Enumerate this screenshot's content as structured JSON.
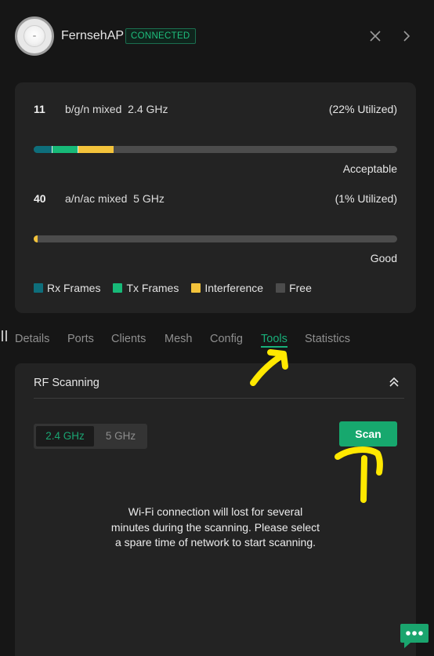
{
  "header": {
    "device_name": "FernsehAP",
    "status": "CONNECTED",
    "icons": {
      "avatar": "access-point-device",
      "close": "close-icon",
      "next": "chevron-right-icon"
    }
  },
  "radios": [
    {
      "channel": "11",
      "mode": "b/g/n mixed  2.4 GHz",
      "utilization": "(22% Utilized)",
      "quality": "Acceptable",
      "segments": {
        "rx_percent": 5,
        "tx_percent": 7,
        "interference_percent": 10
      }
    },
    {
      "channel": "40",
      "mode": "a/n/ac mixed  5 GHz",
      "utilization": "(1% Utilized)",
      "quality": "Good",
      "segments": {
        "rx_percent": 0,
        "tx_percent": 0,
        "interference_percent": 1
      }
    }
  ],
  "legend": [
    {
      "label": "Rx Frames",
      "color": "#0e6e7b"
    },
    {
      "label": "Tx Frames",
      "color": "#17b978"
    },
    {
      "label": "Interference",
      "color": "#f3c33b"
    },
    {
      "label": "Free",
      "color": "#4c4c4c"
    }
  ],
  "tabs": [
    {
      "label": "Details"
    },
    {
      "label": "Ports"
    },
    {
      "label": "Clients"
    },
    {
      "label": "Mesh"
    },
    {
      "label": "Config"
    },
    {
      "label": "Tools",
      "active": true
    },
    {
      "label": "Statistics"
    }
  ],
  "rf_scanning": {
    "title": "RF Scanning",
    "band_options": [
      "2.4 GHz",
      "5 GHz"
    ],
    "selected_band": "2.4 GHz",
    "scan_label": "Scan",
    "warning": "Wi-Fi connection will lost for several minutes during the scanning. Please select a spare time of network to start scanning."
  },
  "colors": {
    "accent": "#18b07a",
    "annotation": "#ffe800",
    "chat": "#1aa56e"
  }
}
